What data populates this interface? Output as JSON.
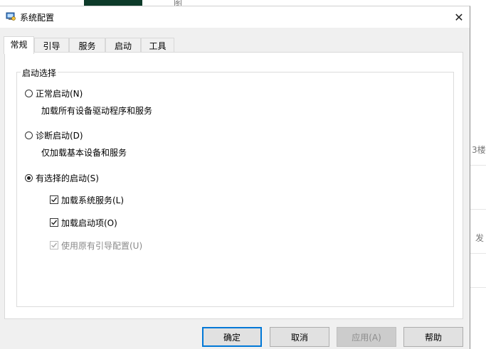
{
  "background": {
    "fragment_top": "图",
    "fragment_right_1": "3楼",
    "fragment_right_2": "发"
  },
  "window": {
    "title": "系统配置",
    "close_glyph": "✕"
  },
  "tabs": [
    {
      "label": "常规",
      "active": true
    },
    {
      "label": "引导",
      "active": false
    },
    {
      "label": "服务",
      "active": false
    },
    {
      "label": "启动",
      "active": false
    },
    {
      "label": "工具",
      "active": false
    }
  ],
  "startup_selection": {
    "group_label": "启动选择",
    "normal": {
      "label": "正常启动(N)",
      "description": "加载所有设备驱动程序和服务",
      "selected": false
    },
    "diagnostic": {
      "label": "诊断启动(D)",
      "description": "仅加载基本设备和服务",
      "selected": false
    },
    "selective": {
      "label": "有选择的启动(S)",
      "selected": true
    },
    "options": [
      {
        "label": "加载系统服务(L)",
        "checked": true,
        "enabled": true
      },
      {
        "label": "加载启动项(O)",
        "checked": true,
        "enabled": true
      },
      {
        "label": "使用原有引导配置(U)",
        "checked": true,
        "enabled": false
      }
    ]
  },
  "buttons": {
    "ok": "确定",
    "cancel": "取消",
    "apply": "应用(A)",
    "help": "帮助"
  },
  "colors": {
    "accent": "#0078d7",
    "dialog_bg": "#f0f0f0"
  }
}
